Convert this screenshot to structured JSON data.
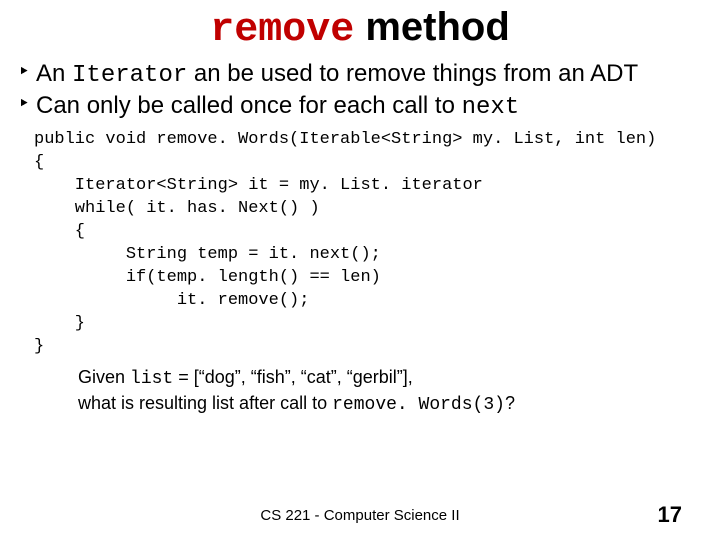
{
  "title": {
    "code": "remove",
    "rest": " method"
  },
  "bullets": [
    {
      "pre": "An ",
      "code": "Iterator",
      "post": " an be used to remove things from an ADT"
    },
    {
      "pre": "Can only be called once for each call to ",
      "code": "next",
      "post": ""
    }
  ],
  "code": "public void remove. Words(Iterable<String> my. List, int len)\n{\n    Iterator<String> it = my. List. iterator\n    while( it. has. Next() )\n    {\n         String temp = it. next();\n         if(temp. length() == len)\n              it. remove();\n    }\n}",
  "question": {
    "line1_pre": "Given ",
    "line1_code": "list",
    "line1_post": " = [“dog”, “fish”, “cat”, “gerbil”],",
    "line2_pre": "what is resulting list after call to ",
    "line2_code": "remove. Words(3)",
    "line2_post": "?"
  },
  "footer": "CS 221 - Computer Science II",
  "page": "17",
  "bullet_marker": "‣"
}
